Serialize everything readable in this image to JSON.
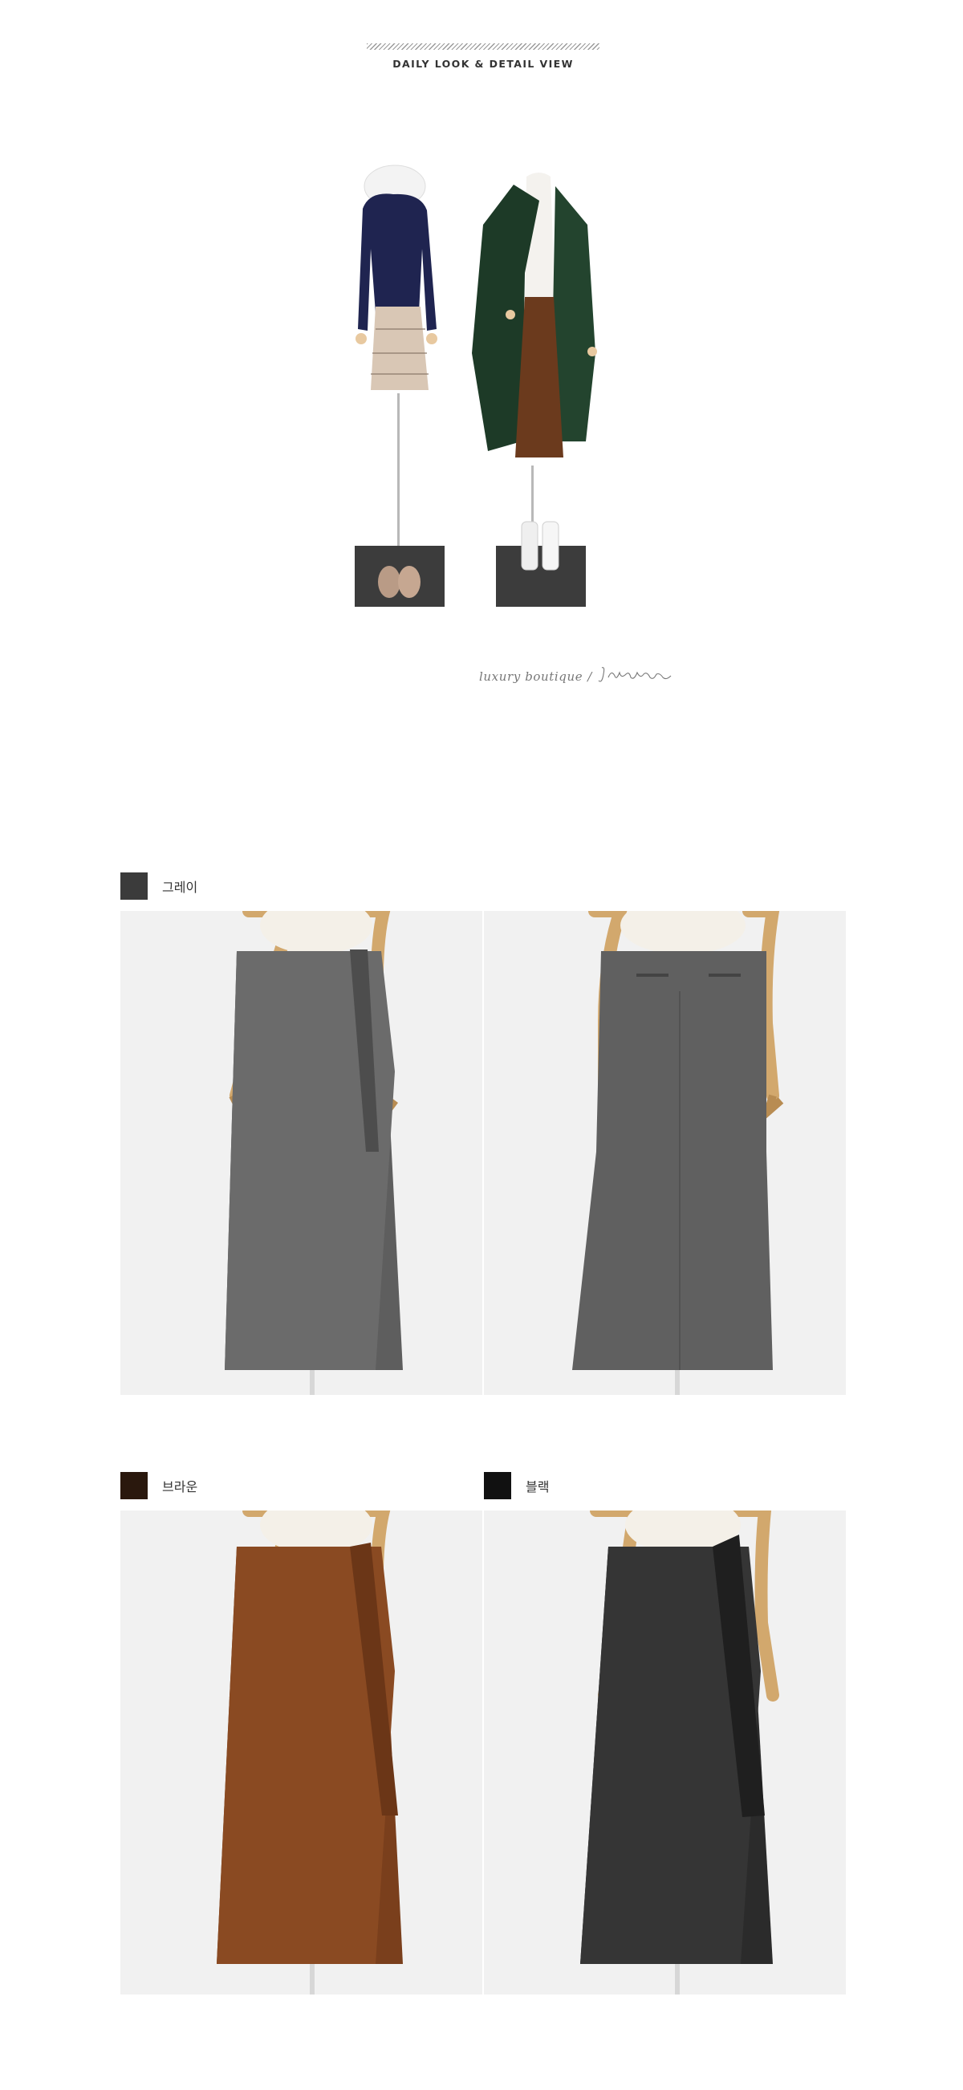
{
  "header": {
    "title": "DAILY LOOK & DETAIL VIEW"
  },
  "signature": {
    "text": "luxury boutique",
    "separator": "/",
    "script_name": "Jblanc"
  },
  "colors": {
    "gray": "#3b3b3b",
    "brown": "#2a180d",
    "black": "#111111",
    "accent_line": "#9a9a9a"
  },
  "products": [
    {
      "color_label": "그레이",
      "swatch_color": "#3b3b3b"
    },
    {
      "color_label": "브라운",
      "swatch_color": "#2a180d"
    },
    {
      "color_label": "블랙",
      "swatch_color": "#111111"
    }
  ]
}
